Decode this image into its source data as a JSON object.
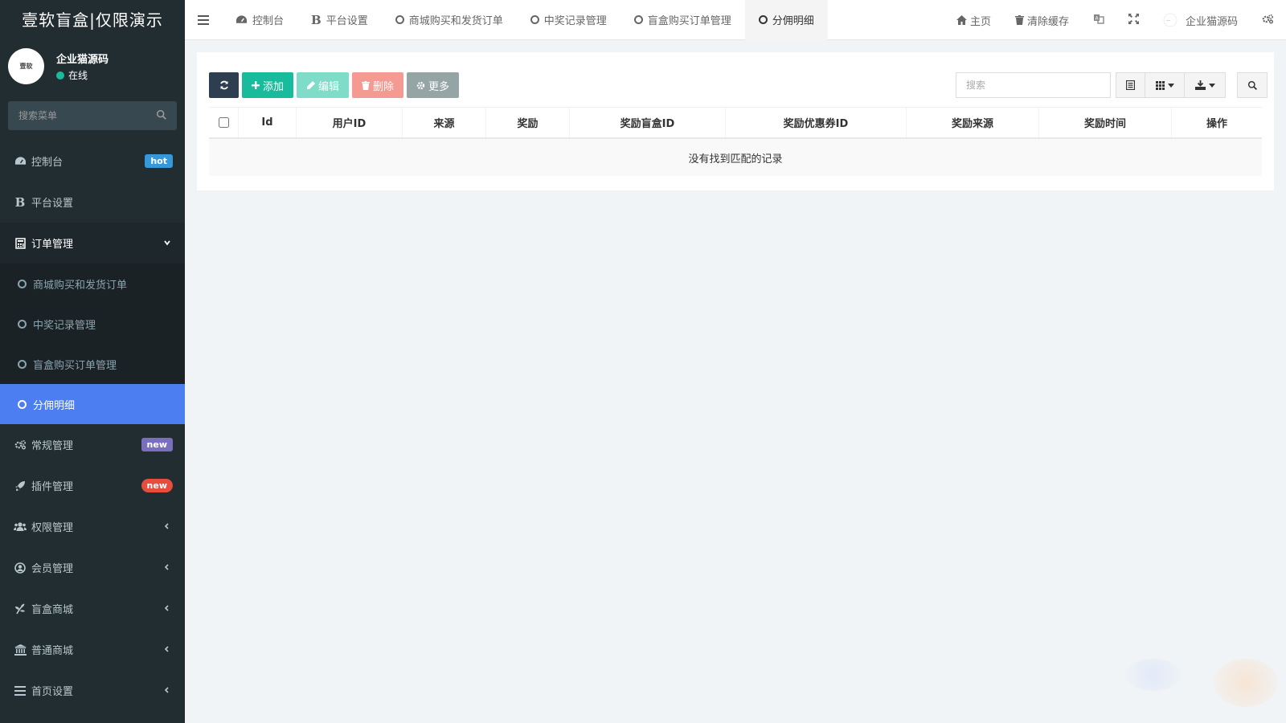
{
  "app": {
    "title": "壹软盲盒|仅限演示"
  },
  "user": {
    "name": "企业猫源码",
    "status": "在线",
    "avatar_text": "壹软"
  },
  "sidebar": {
    "search_placeholder": "搜索菜单",
    "items": [
      {
        "label": "控制台",
        "icon": "dashboard-icon",
        "badge": "hot"
      },
      {
        "label": "平台设置",
        "icon": "bold-b-icon"
      },
      {
        "label": "订单管理",
        "icon": "calculator-icon",
        "children": [
          {
            "label": "商城购买和发货订单"
          },
          {
            "label": "中奖记录管理"
          },
          {
            "label": "盲盒购买订单管理"
          },
          {
            "label": "分佣明细",
            "active": true
          }
        ]
      },
      {
        "label": "常规管理",
        "icon": "cogs-icon",
        "badge": "new"
      },
      {
        "label": "插件管理",
        "icon": "rocket-icon",
        "badge": "new"
      },
      {
        "label": "权限管理",
        "icon": "group-icon"
      },
      {
        "label": "会员管理",
        "icon": "user-circle-icon"
      },
      {
        "label": "盲盒商城",
        "icon": "pagelines-icon"
      },
      {
        "label": "普通商城",
        "icon": "institution-icon"
      },
      {
        "label": "首页设置",
        "icon": "list-icon"
      }
    ]
  },
  "topbar": {
    "tabs": [
      {
        "label": "控制台",
        "icon": "dashboard-icon"
      },
      {
        "label": "平台设置",
        "icon": "bold-b-icon"
      },
      {
        "label": "商城购买和发货订单",
        "icon": "circle-icon"
      },
      {
        "label": "中奖记录管理",
        "icon": "circle-icon"
      },
      {
        "label": "盲盒购买订单管理",
        "icon": "circle-icon"
      },
      {
        "label": "分佣明细",
        "icon": "circle-icon",
        "active": true
      }
    ],
    "right": {
      "home": "主页",
      "clear_cache": "清除缓存",
      "user": "企业猫源码"
    }
  },
  "toolbar": {
    "add": "添加",
    "edit": "编辑",
    "delete": "删除",
    "more": "更多",
    "search_placeholder": "搜索"
  },
  "table": {
    "columns": [
      "Id",
      "用户ID",
      "来源",
      "奖励",
      "奖励盲盒ID",
      "奖励优惠券ID",
      "奖励来源",
      "奖励时间",
      "操作"
    ],
    "empty_text": "没有找到匹配的记录"
  },
  "colors": {
    "sidebar_bg": "#222d32",
    "active_item": "#4c7ef2",
    "add": "#18bc9c",
    "edit": "#7fdcc8",
    "delete": "#f49a92",
    "more": "#95a5a6",
    "refresh": "#2c3e50"
  }
}
